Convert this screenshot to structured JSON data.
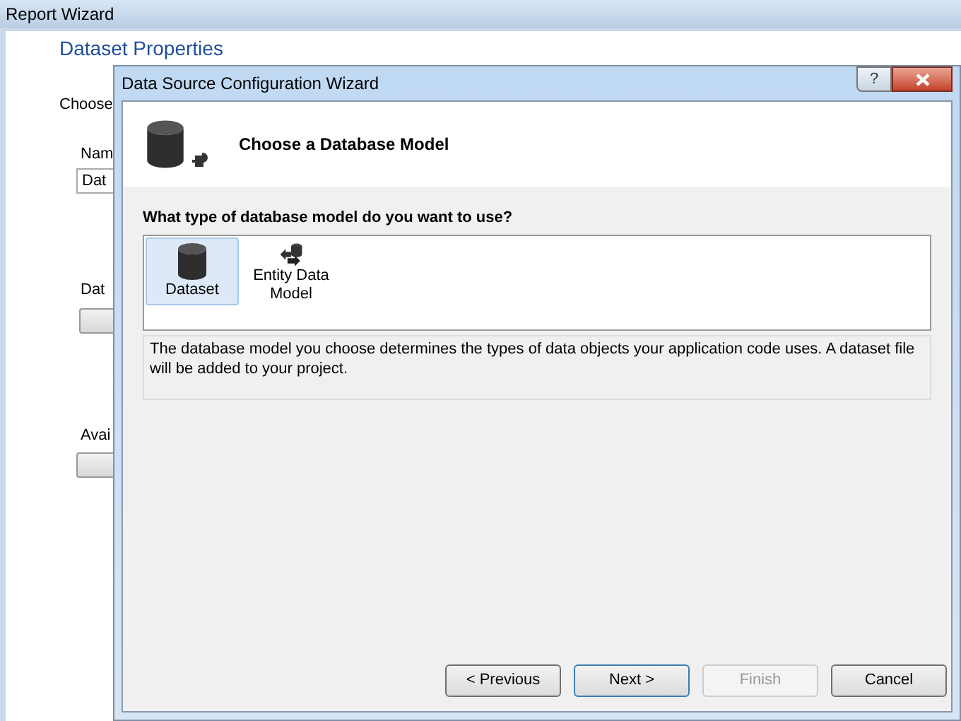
{
  "background_window": {
    "title": "Report Wizard",
    "heading": "Dataset Properties",
    "labels": [
      "Choose",
      "Nam",
      "Dat",
      "Dat",
      "Avai"
    ]
  },
  "dialog": {
    "title": "Data Source Configuration Wizard",
    "help": "?",
    "header": "Choose a Database Model",
    "question": "What type of database model do you want to use?",
    "models": [
      {
        "label": "Dataset",
        "kind": "dataset",
        "selected": true
      },
      {
        "label": "Entity Data Model",
        "kind": "entity",
        "selected": false
      }
    ],
    "description": "The database model you choose determines the types of data objects your application code uses. A dataset file will be added to your project.",
    "buttons": [
      {
        "label": "< Previous",
        "disabled": false,
        "default": false
      },
      {
        "label": "Next >",
        "disabled": false,
        "default": true
      },
      {
        "label": "Finish",
        "disabled": true,
        "default": false
      },
      {
        "label": "Cancel",
        "disabled": false,
        "default": false
      }
    ]
  }
}
